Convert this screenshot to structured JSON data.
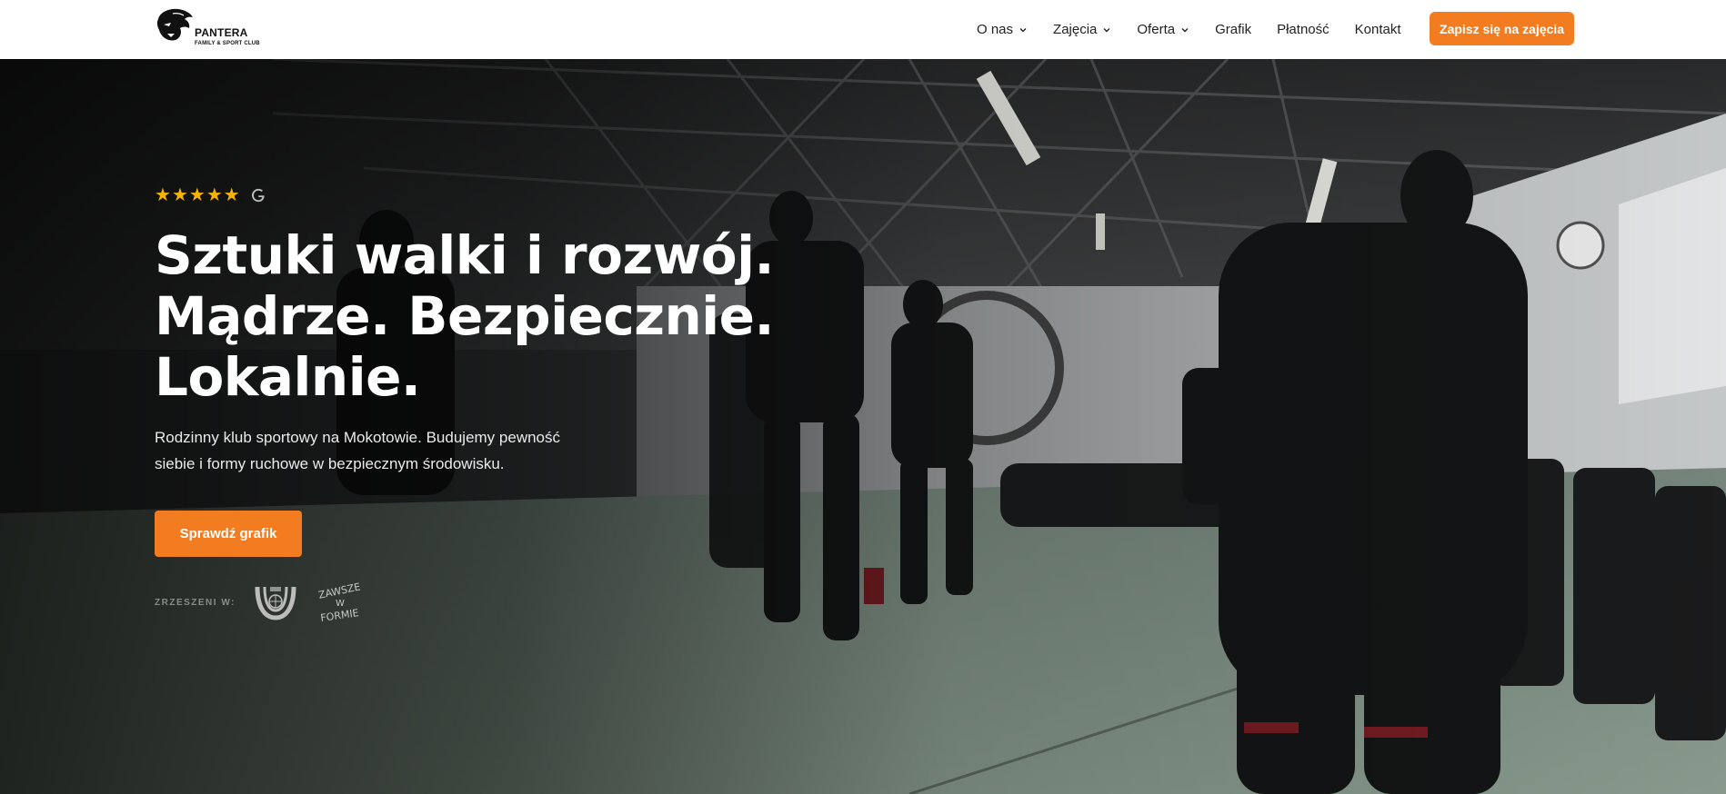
{
  "brand": {
    "name": "PANTERA",
    "tagline": "FAMILY & SPORT CLUB",
    "logo_icon": "panther-head-icon"
  },
  "nav": {
    "items": [
      {
        "label": "O nas",
        "has_dropdown": true
      },
      {
        "label": "Zajęcia",
        "has_dropdown": true
      },
      {
        "label": "Oferta",
        "has_dropdown": true
      },
      {
        "label": "Grafik",
        "has_dropdown": false
      },
      {
        "label": "Płatność",
        "has_dropdown": false
      },
      {
        "label": "Kontakt",
        "has_dropdown": false
      }
    ],
    "cta_label": "Zapisz się na zajęcia"
  },
  "hero": {
    "rating_stars": 5,
    "rating_source_icon": "google-icon",
    "headline_lines": [
      "Sztuki walki i rozwój.",
      "Mądrze. Bezpiecznie.",
      "Lokalnie."
    ],
    "subtitle": "Rodzinny klub sportowy na Mokotowie. Budujemy pewność siebie i formy ruchowe w bezpiecznym środowisku.",
    "cta_label": "Sprawdź grafik",
    "associations_label": "ZRZESZENI W:",
    "association_logos": [
      {
        "icon": "organization-emblem-icon"
      },
      {
        "icon": "zawsze-w-formie-logo",
        "text": "ZAWSZE W FORMIE"
      }
    ],
    "background": "gym-training-photo"
  },
  "colors": {
    "accent": "#f47c20",
    "star": "#f5b400",
    "header_bg": "#ffffff",
    "hero_text": "#ffffff"
  }
}
